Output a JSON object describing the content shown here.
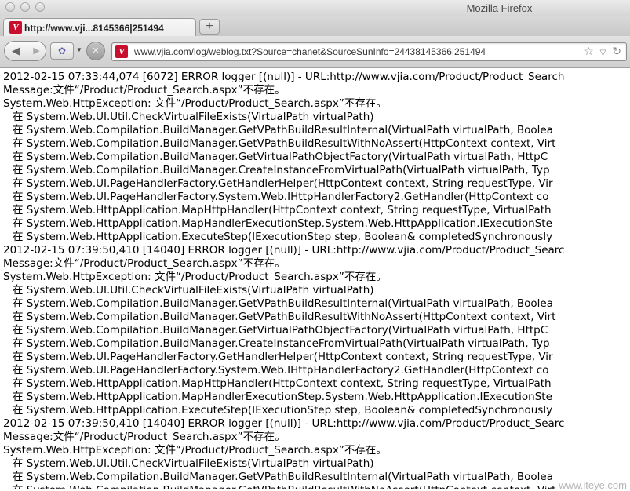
{
  "window": {
    "title": "Mozilla Firefox"
  },
  "tabs": [
    {
      "label": "http://www.vji...8145366|251494"
    }
  ],
  "new_tab_label": "+",
  "nav": {
    "back_glyph": "◀",
    "forward_glyph": "▶",
    "url": "www.vjia.com/log/weblog.txt?Source=chanet&SourceSunInfo=24438145366|251494",
    "favicon_letter": "V"
  },
  "log_lines": [
    {
      "text": "2012-02-15 07:33:44,074 [6072] ERROR logger [(null)] - URL:http://www.vjia.com/Product/Product_Search",
      "indent": false
    },
    {
      "text": "Message:文件“/Product/Product_Search.aspx”不存在。",
      "indent": false
    },
    {
      "text": "System.Web.HttpException: 文件“/Product/Product_Search.aspx”不存在。",
      "indent": false
    },
    {
      "text": "在 System.Web.UI.Util.CheckVirtualFileExists(VirtualPath virtualPath)",
      "indent": true
    },
    {
      "text": "在 System.Web.Compilation.BuildManager.GetVPathBuildResultInternal(VirtualPath virtualPath, Boolea",
      "indent": true
    },
    {
      "text": "在 System.Web.Compilation.BuildManager.GetVPathBuildResultWithNoAssert(HttpContext context, Virt",
      "indent": true
    },
    {
      "text": "在 System.Web.Compilation.BuildManager.GetVirtualPathObjectFactory(VirtualPath virtualPath, HttpC",
      "indent": true
    },
    {
      "text": "在 System.Web.Compilation.BuildManager.CreateInstanceFromVirtualPath(VirtualPath virtualPath, Typ",
      "indent": true
    },
    {
      "text": "在 System.Web.UI.PageHandlerFactory.GetHandlerHelper(HttpContext context, String requestType, Vir",
      "indent": true
    },
    {
      "text": "在 System.Web.UI.PageHandlerFactory.System.Web.IHttpHandlerFactory2.GetHandler(HttpContext co",
      "indent": true
    },
    {
      "text": "在 System.Web.HttpApplication.MapHttpHandler(HttpContext context, String requestType, VirtualPath",
      "indent": true
    },
    {
      "text": "在 System.Web.HttpApplication.MapHandlerExecutionStep.System.Web.HttpApplication.IExecutionSte",
      "indent": true
    },
    {
      "text": "在 System.Web.HttpApplication.ExecuteStep(IExecutionStep step, Boolean& completedSynchronously",
      "indent": true
    },
    {
      "text": "2012-02-15 07:39:50,410 [14040] ERROR logger [(null)] - URL:http://www.vjia.com/Product/Product_Searc",
      "indent": false
    },
    {
      "text": "Message:文件“/Product/Product_Search.aspx”不存在。",
      "indent": false
    },
    {
      "text": "System.Web.HttpException: 文件“/Product/Product_Search.aspx”不存在。",
      "indent": false
    },
    {
      "text": "在 System.Web.UI.Util.CheckVirtualFileExists(VirtualPath virtualPath)",
      "indent": true
    },
    {
      "text": "在 System.Web.Compilation.BuildManager.GetVPathBuildResultInternal(VirtualPath virtualPath, Boolea",
      "indent": true
    },
    {
      "text": "在 System.Web.Compilation.BuildManager.GetVPathBuildResultWithNoAssert(HttpContext context, Virt",
      "indent": true
    },
    {
      "text": "在 System.Web.Compilation.BuildManager.GetVirtualPathObjectFactory(VirtualPath virtualPath, HttpC",
      "indent": true
    },
    {
      "text": "在 System.Web.Compilation.BuildManager.CreateInstanceFromVirtualPath(VirtualPath virtualPath, Typ",
      "indent": true
    },
    {
      "text": "在 System.Web.UI.PageHandlerFactory.GetHandlerHelper(HttpContext context, String requestType, Vir",
      "indent": true
    },
    {
      "text": "在 System.Web.UI.PageHandlerFactory.System.Web.IHttpHandlerFactory2.GetHandler(HttpContext co",
      "indent": true
    },
    {
      "text": "在 System.Web.HttpApplication.MapHttpHandler(HttpContext context, String requestType, VirtualPath",
      "indent": true
    },
    {
      "text": "在 System.Web.HttpApplication.MapHandlerExecutionStep.System.Web.HttpApplication.IExecutionSte",
      "indent": true
    },
    {
      "text": "在 System.Web.HttpApplication.ExecuteStep(IExecutionStep step, Boolean& completedSynchronously",
      "indent": true
    },
    {
      "text": "2012-02-15 07:39:50,410 [14040] ERROR logger [(null)] - URL:http://www.vjia.com/Product/Product_Searc",
      "indent": false
    },
    {
      "text": "Message:文件“/Product/Product_Search.aspx”不存在。",
      "indent": false
    },
    {
      "text": "System.Web.HttpException: 文件“/Product/Product_Search.aspx”不存在。",
      "indent": false
    },
    {
      "text": "在 System.Web.UI.Util.CheckVirtualFileExists(VirtualPath virtualPath)",
      "indent": true
    },
    {
      "text": "在 System.Web.Compilation.BuildManager.GetVPathBuildResultInternal(VirtualPath virtualPath, Boolea",
      "indent": true
    },
    {
      "text": "在 System.Web.Compilation.BuildManager.GetVPathBuildResultWithNoAssert(HttpContext context, Virt",
      "indent": true
    }
  ],
  "watermark": "www.iteye.com"
}
